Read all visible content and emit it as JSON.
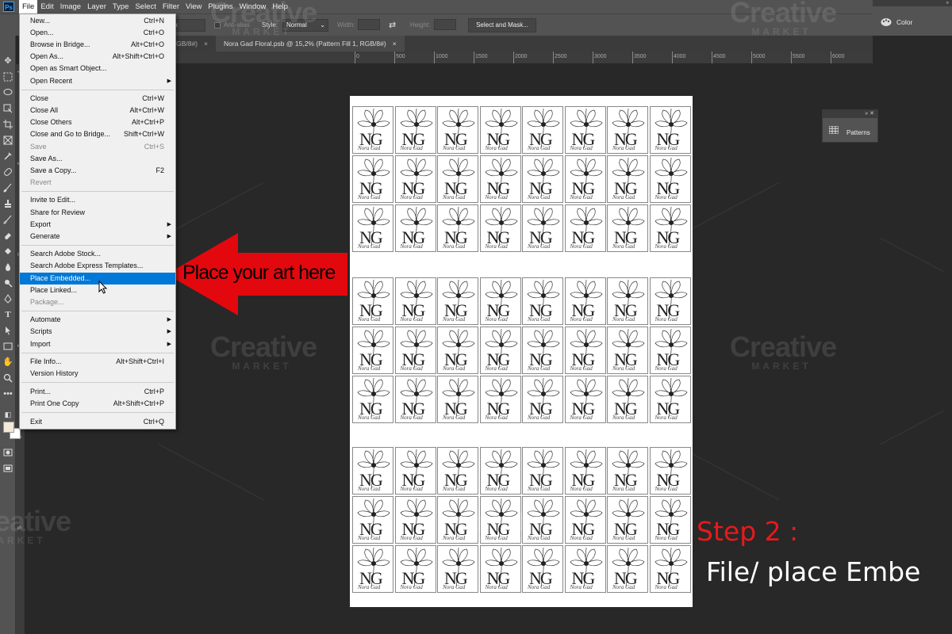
{
  "app": {
    "logo": "Ps"
  },
  "menubar": [
    "File",
    "Edit",
    "Image",
    "Layer",
    "Type",
    "Select",
    "Filter",
    "View",
    "Plugins",
    "Window",
    "Help"
  ],
  "options": {
    "feather_value": "0 px",
    "anti_alias": "Anti-alias",
    "style_label": "Style:",
    "style_value": "Normal",
    "width_label": "Width:",
    "height_label": "Height:",
    "select_mask": "Select and Mask..."
  },
  "tabs": [
    {
      "label": "t bhere, RGB/8#)",
      "close": "×"
    },
    {
      "label": "Nora Gad Floral.psb @ 15,2% (Pattern Fill 1, RGB/8#)",
      "close": "×"
    }
  ],
  "ruler": {
    "top": [
      "0",
      "500",
      "1000",
      "1500",
      "2000",
      "2500",
      "3000",
      "3500",
      "4000",
      "4500",
      "5000",
      "5500",
      "6000"
    ],
    "left": [
      "4",
      "5",
      "0",
      "5",
      "0",
      "5"
    ]
  },
  "panels": {
    "color_label": "Color",
    "color_header": "»",
    "patterns_label": "Patterns",
    "patterns_header": "» ✕"
  },
  "file_menu": [
    {
      "label": "New...",
      "shortcut": "Ctrl+N"
    },
    {
      "label": "Open...",
      "shortcut": "Ctrl+O"
    },
    {
      "label": "Browse in Bridge...",
      "shortcut": "Alt+Ctrl+O"
    },
    {
      "label": "Open As...",
      "shortcut": "Alt+Shift+Ctrl+O"
    },
    {
      "label": "Open as Smart Object...",
      "shortcut": ""
    },
    {
      "label": "Open Recent",
      "shortcut": "",
      "submenu": true
    },
    {
      "sep": true
    },
    {
      "label": "Close",
      "shortcut": "Ctrl+W"
    },
    {
      "label": "Close All",
      "shortcut": "Alt+Ctrl+W"
    },
    {
      "label": "Close Others",
      "shortcut": "Alt+Ctrl+P"
    },
    {
      "label": "Close and Go to Bridge...",
      "shortcut": "Shift+Ctrl+W"
    },
    {
      "label": "Save",
      "shortcut": "Ctrl+S",
      "disabled": true
    },
    {
      "label": "Save As...",
      "shortcut": ""
    },
    {
      "label": "Save a Copy...",
      "shortcut": "F2"
    },
    {
      "label": "Revert",
      "shortcut": "",
      "disabled": true
    },
    {
      "sep": true
    },
    {
      "label": "Invite to Edit...",
      "shortcut": ""
    },
    {
      "label": "Share for Review",
      "shortcut": ""
    },
    {
      "label": "Export",
      "shortcut": "",
      "submenu": true
    },
    {
      "label": "Generate",
      "shortcut": "",
      "submenu": true
    },
    {
      "sep": true
    },
    {
      "label": "Search Adobe Stock...",
      "shortcut": ""
    },
    {
      "label": "Search Adobe Express Templates...",
      "shortcut": ""
    },
    {
      "label": "Place Embedded...",
      "shortcut": "",
      "highlighted": true
    },
    {
      "label": "Place Linked...",
      "shortcut": ""
    },
    {
      "label": "Package...",
      "shortcut": "",
      "disabled": true
    },
    {
      "sep": true
    },
    {
      "label": "Automate",
      "shortcut": "",
      "submenu": true
    },
    {
      "label": "Scripts",
      "shortcut": "",
      "submenu": true
    },
    {
      "label": "Import",
      "shortcut": "",
      "submenu": true
    },
    {
      "sep": true
    },
    {
      "label": "File Info...",
      "shortcut": "Alt+Shift+Ctrl+I"
    },
    {
      "label": "Version History",
      "shortcut": ""
    },
    {
      "sep": true
    },
    {
      "label": "Print...",
      "shortcut": "Ctrl+P"
    },
    {
      "label": "Print One Copy",
      "shortcut": "Alt+Shift+Ctrl+P"
    },
    {
      "sep": true
    },
    {
      "label": "Exit",
      "shortcut": "Ctrl+Q"
    }
  ],
  "annotation": {
    "arrow_label": "Place your art here",
    "step_title": "Step 2 :",
    "step_text": "File/ place Embe",
    "arrow_color": "#e3080e"
  },
  "tile": {
    "mono": "NG",
    "caption": "Nora Gad"
  },
  "watermark": {
    "line1": "Creative",
    "line2": "MARKET"
  },
  "colors": {
    "highlight": "#0078d7",
    "canvas": "#282828",
    "panel": "#535353"
  }
}
